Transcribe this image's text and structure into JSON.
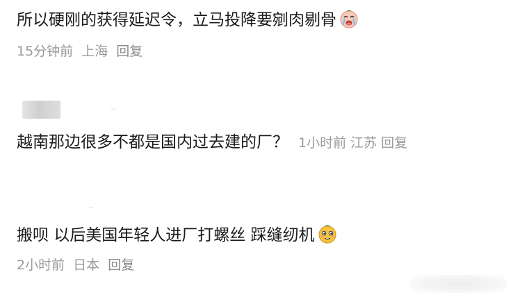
{
  "comments": [
    {
      "text": "所以硬刚的获得延迟令，立马投降要剜肉剔骨",
      "emoji_icon": "crying-face-emoji-icon",
      "time": "15分钟前",
      "location": "上海",
      "reply_label": "回复"
    },
    {
      "text": "越南那边很多不都是国内过去建的厂？",
      "time": "1小时前",
      "location": "江苏",
      "reply_label": "回复"
    },
    {
      "text": "搬呗 以后美国年轻人进厂打螺丝 踩缝纫机",
      "emoji_icon": "smug-face-emoji-icon",
      "time": "2小时前",
      "location": "日本",
      "reply_label": "回复"
    }
  ],
  "colors": {
    "text": "#1a1a1a",
    "meta": "#9a9a9a",
    "emoji_peach": "#f6c6b8",
    "emoji_yellow": "#f5c542",
    "tears": "#6ec6f0"
  }
}
